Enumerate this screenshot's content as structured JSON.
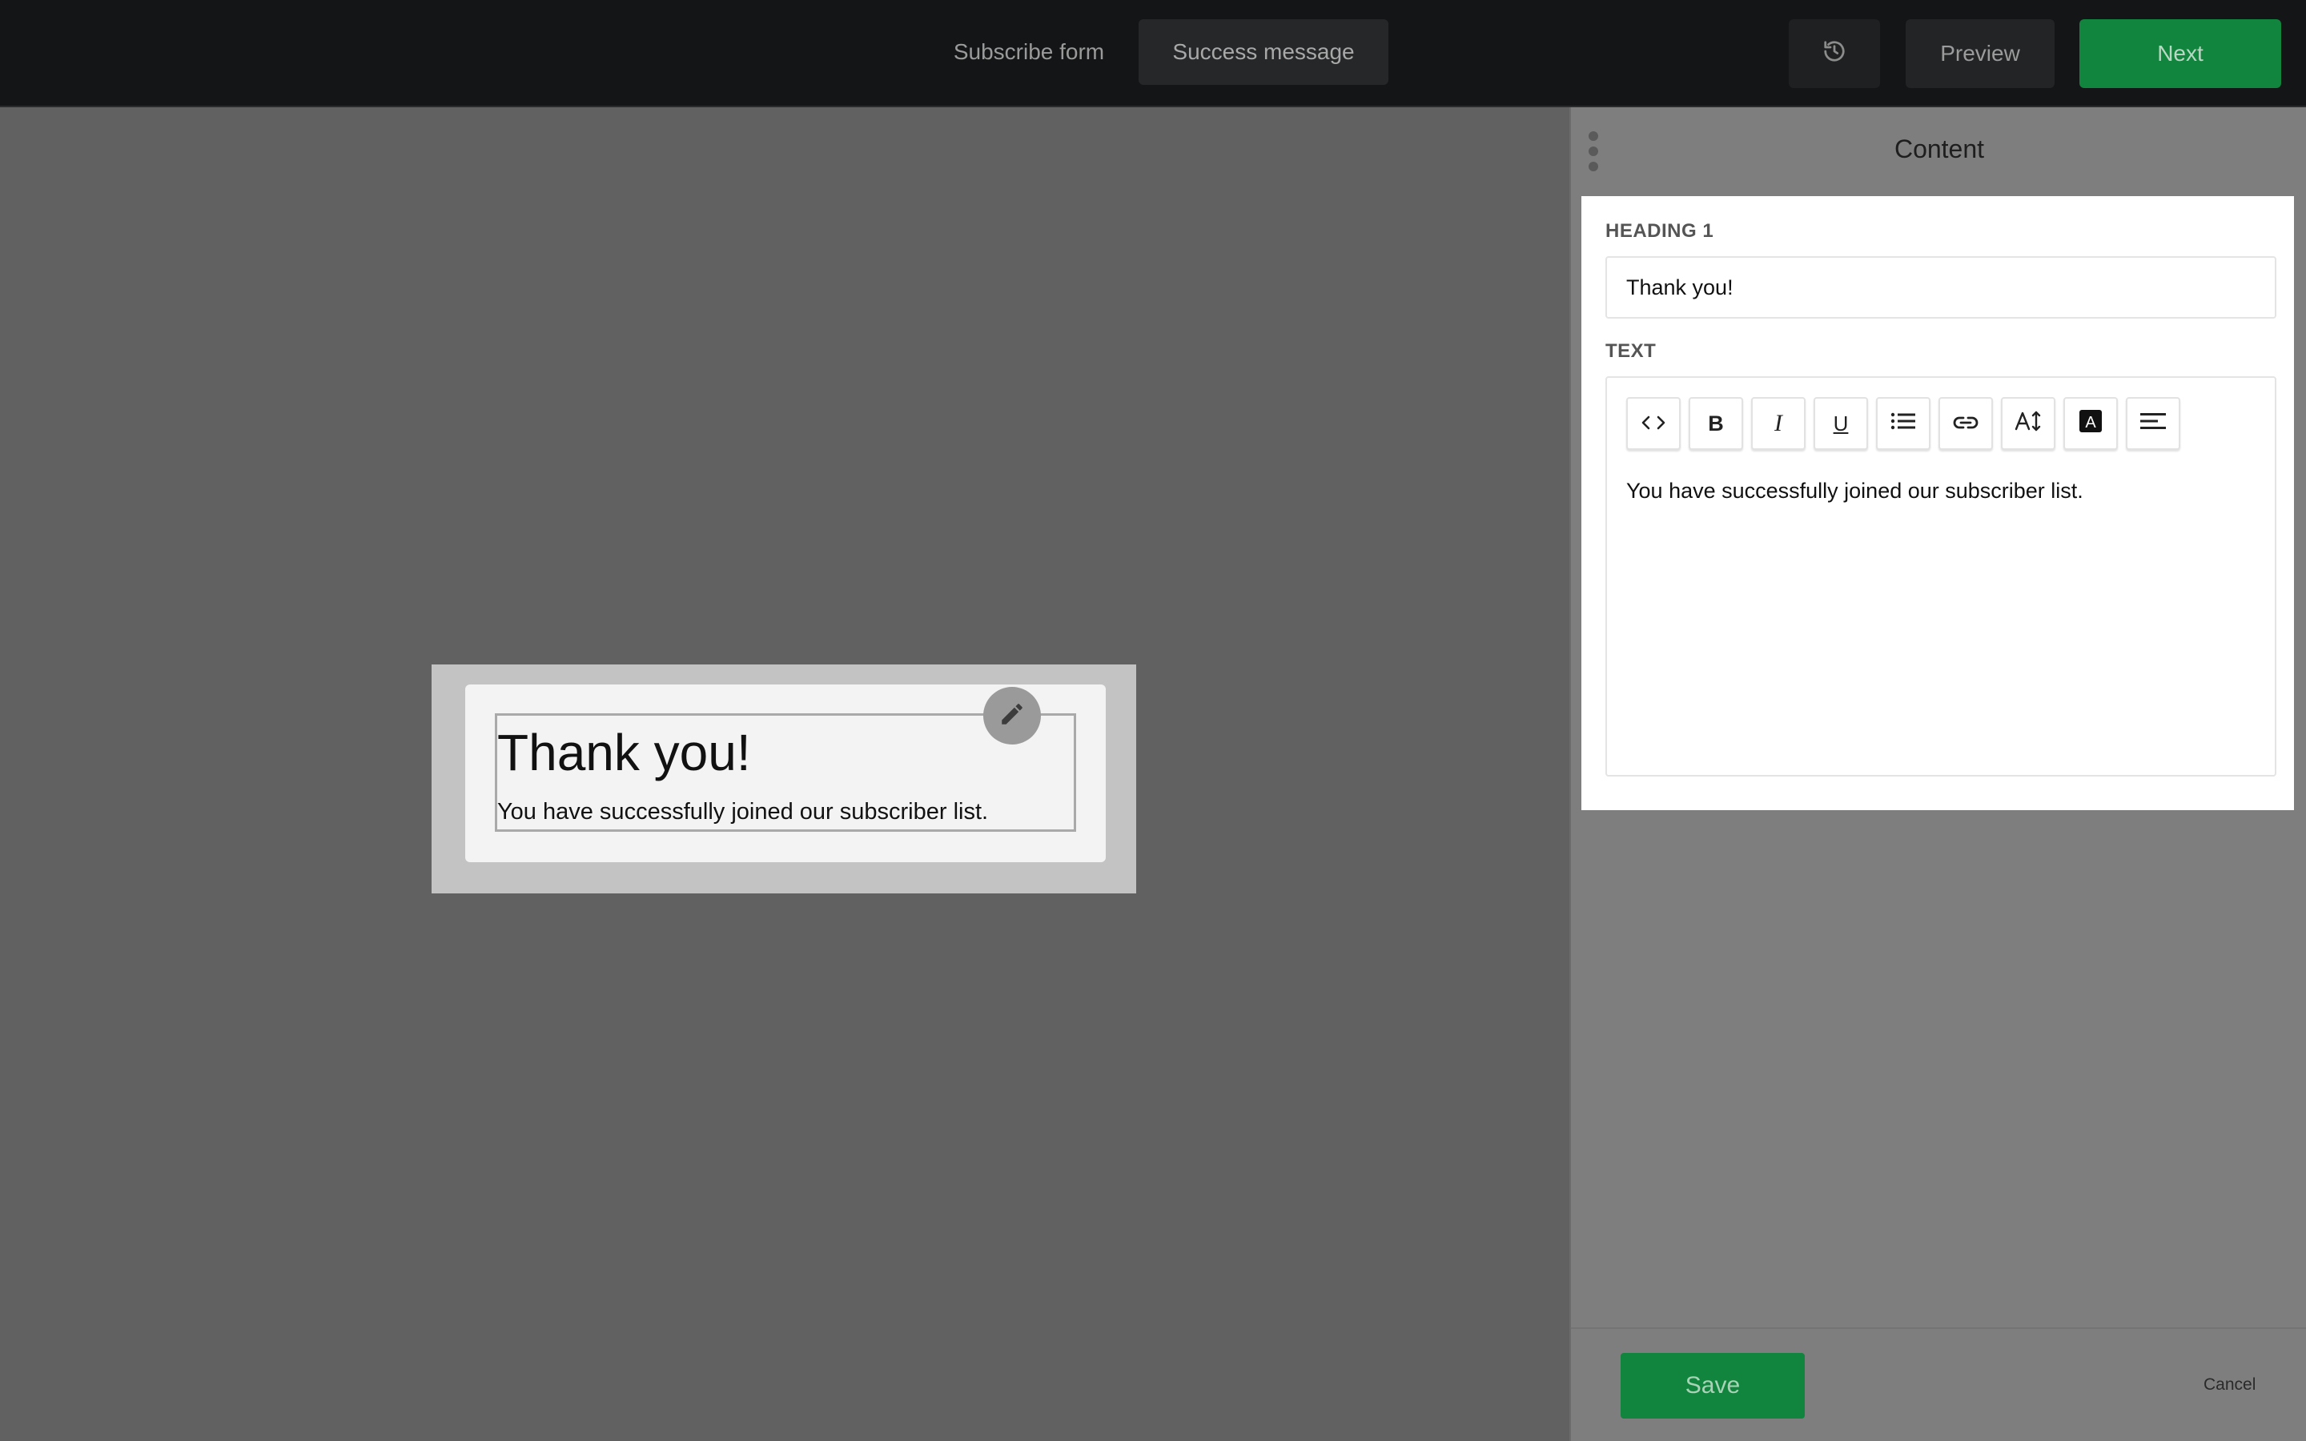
{
  "topbar": {
    "tabs": [
      {
        "label": "Subscribe form"
      },
      {
        "label": "Success message"
      }
    ],
    "preview_label": "Preview",
    "next_label": "Next"
  },
  "canvas": {
    "form": {
      "heading": "Thank you!",
      "text": "You have successfully joined our subscriber list."
    }
  },
  "panel": {
    "title": "Content",
    "heading_label": "HEADING 1",
    "heading_value": "Thank you!",
    "text_label": "TEXT",
    "text_value": "You have successfully joined our subscriber list.",
    "toolbar": [
      "code-icon",
      "bold-icon",
      "italic-icon",
      "underline-icon",
      "list-icon",
      "link-icon",
      "font-size-icon",
      "text-color-icon",
      "align-icon"
    ],
    "save_label": "Save",
    "cancel_label": "Cancel"
  },
  "colors": {
    "accent_green": "#11843d",
    "topbar_bg": "#141516",
    "canvas_bg": "#616161"
  }
}
